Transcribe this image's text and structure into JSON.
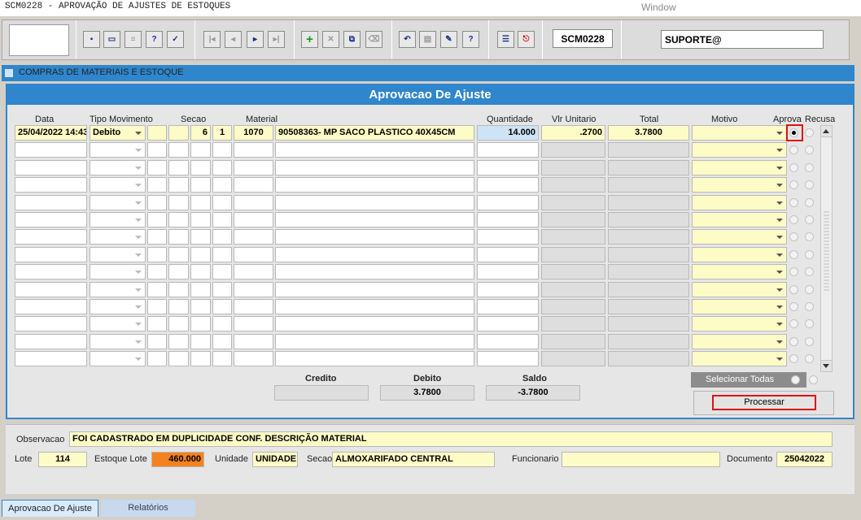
{
  "window": {
    "title": "SCM0228 - APROVAÇÃO DE AJUSTES DE ESTOQUES",
    "menu": "Window"
  },
  "toolbar": {
    "screen_code": "SCM0228",
    "user": "SUPORTE@"
  },
  "module": {
    "title": "COMPRAS DE MATERIAIS E ESTOQUE"
  },
  "panel": {
    "title": "Aprovacao De Ajuste",
    "headers": {
      "data": "Data",
      "tipo": "Tipo Movimento",
      "secao": "Secao",
      "material": "Material",
      "quantidade": "Quantidade",
      "vlr_unitario": "Vlr Unitario",
      "total": "Total",
      "motivo": "Motivo",
      "aprova": "Aprova",
      "recusa": "Recusa"
    },
    "row1": {
      "data": "25/04/2022 14:43",
      "tipo": "Debito",
      "secao_a": "6",
      "secao_b": "1",
      "material_code": "1070",
      "material_desc": "90508363- MP SACO PLASTICO 40X45CM",
      "quantidade": "14.000",
      "vlr_unitario": ".2700",
      "total": "3.7800",
      "motivo": "",
      "aprova": true
    }
  },
  "totals": {
    "credito_label": "Credito",
    "debito_label": "Debito",
    "saldo_label": "Saldo",
    "credito": "",
    "debito": "3.7800",
    "saldo": "-3.7800"
  },
  "actions": {
    "selecionar_todas": "Selecionar Todas",
    "processar": "Processar"
  },
  "details": {
    "observacao_label": "Observacao",
    "observacao": "FOI CADASTRADO EM DUPLICIDADE CONF. DESCRIÇÃO MATERIAL",
    "lote_label": "Lote",
    "lote": "114",
    "estoque_lote_label": "Estoque Lote",
    "estoque_lote": "460.000",
    "unidade_label": "Unidade",
    "unidade": "UNIDADE",
    "secao_label": "Secao",
    "secao": "ALMOXARIFADO CENTRAL",
    "funcionario_label": "Funcionario",
    "funcionario": "",
    "documento_label": "Documento",
    "documento": "25042022"
  },
  "tabs": [
    {
      "label": "Aprovacao De Ajuste"
    },
    {
      "label": "Relatórios"
    }
  ],
  "colors": {
    "accent": "#2f86cc",
    "highlight": "#e01010",
    "field_yellow": "#fdfbc6",
    "field_orange": "#f5821f"
  }
}
